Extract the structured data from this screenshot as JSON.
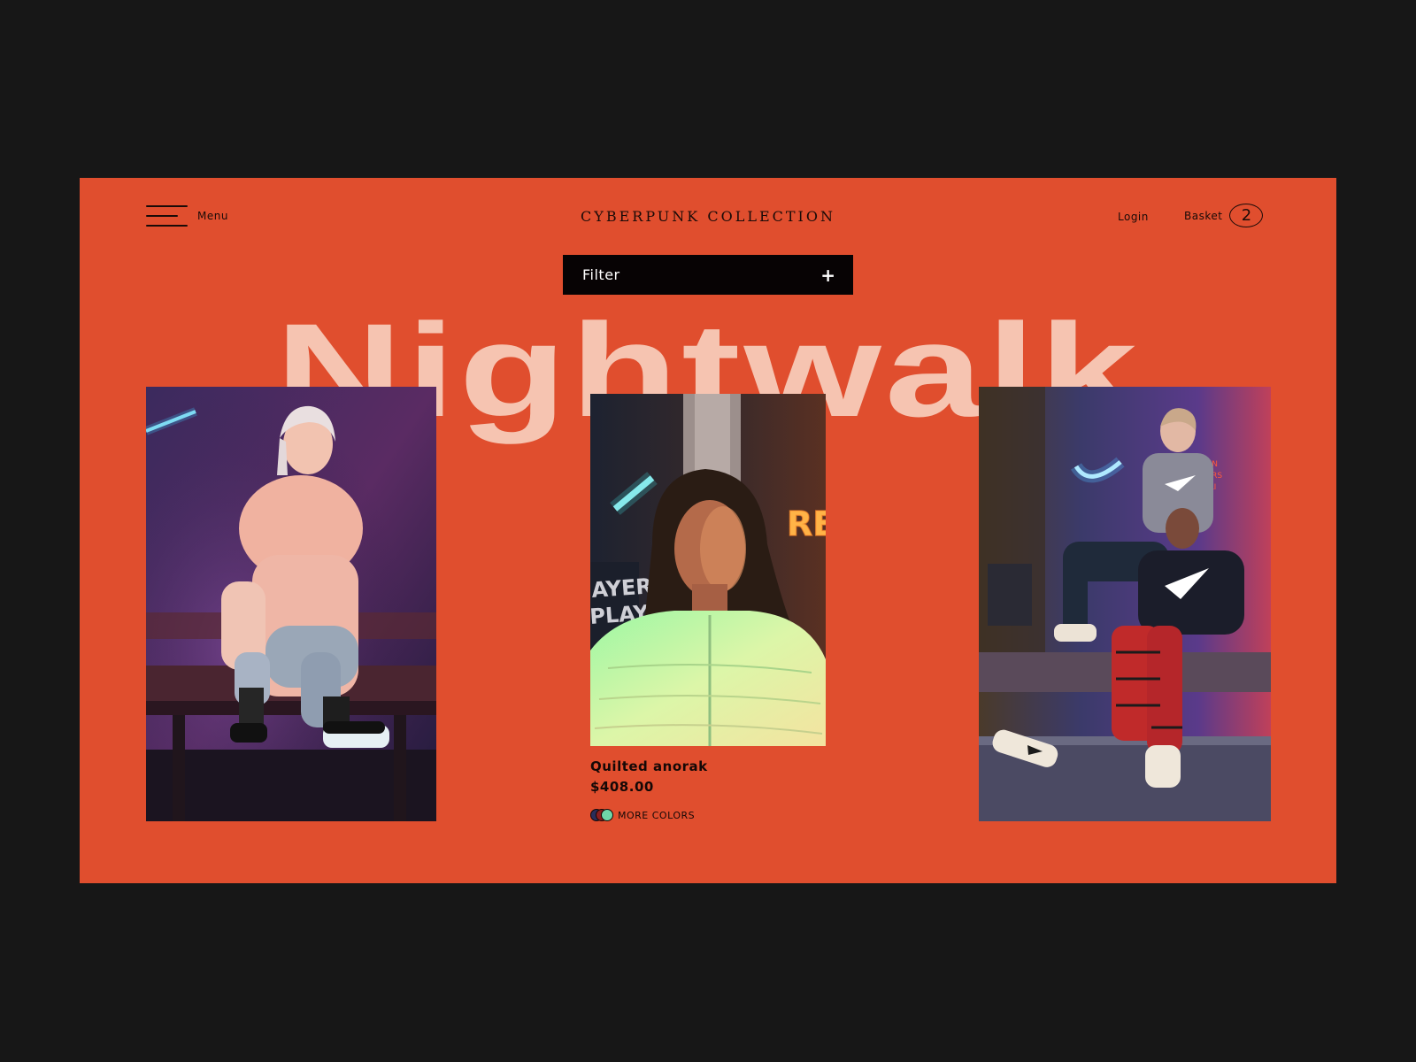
{
  "header": {
    "menu_label": "Menu",
    "brand": "CYBERPUNK COLLECTION",
    "login_label": "Login",
    "basket_label": "Basket",
    "basket_count": "2"
  },
  "filter": {
    "label": "Filter",
    "icon": "+"
  },
  "hero_title": "Nightwalk",
  "products": [
    {
      "image": "photo-woman-on-bench"
    },
    {
      "image": "photo-woman-quilted-anorak",
      "name": "Quilted anorak",
      "price": "$408.00",
      "more_colors": "MORE COLORS"
    },
    {
      "image": "photo-two-men-on-bench"
    }
  ],
  "colors": {
    "page_background": "#171717",
    "frame": "#e04e2e",
    "hero_text": "#f6c4b1",
    "filter_bar": "#070304",
    "swatches": [
      "#2a2d5a",
      "#8b1e1e",
      "#6fd7a8"
    ]
  }
}
